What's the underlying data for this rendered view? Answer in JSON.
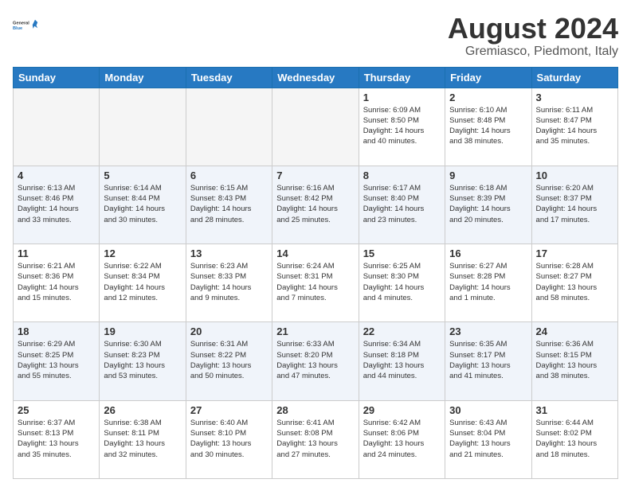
{
  "logo": {
    "line1": "General",
    "line2": "Blue"
  },
  "title": "August 2024",
  "subtitle": "Gremiasco, Piedmont, Italy",
  "days_header": [
    "Sunday",
    "Monday",
    "Tuesday",
    "Wednesday",
    "Thursday",
    "Friday",
    "Saturday"
  ],
  "weeks": [
    [
      {
        "day": "",
        "info": ""
      },
      {
        "day": "",
        "info": ""
      },
      {
        "day": "",
        "info": ""
      },
      {
        "day": "",
        "info": ""
      },
      {
        "day": "1",
        "info": "Sunrise: 6:09 AM\nSunset: 8:50 PM\nDaylight: 14 hours\nand 40 minutes."
      },
      {
        "day": "2",
        "info": "Sunrise: 6:10 AM\nSunset: 8:48 PM\nDaylight: 14 hours\nand 38 minutes."
      },
      {
        "day": "3",
        "info": "Sunrise: 6:11 AM\nSunset: 8:47 PM\nDaylight: 14 hours\nand 35 minutes."
      }
    ],
    [
      {
        "day": "4",
        "info": "Sunrise: 6:13 AM\nSunset: 8:46 PM\nDaylight: 14 hours\nand 33 minutes."
      },
      {
        "day": "5",
        "info": "Sunrise: 6:14 AM\nSunset: 8:44 PM\nDaylight: 14 hours\nand 30 minutes."
      },
      {
        "day": "6",
        "info": "Sunrise: 6:15 AM\nSunset: 8:43 PM\nDaylight: 14 hours\nand 28 minutes."
      },
      {
        "day": "7",
        "info": "Sunrise: 6:16 AM\nSunset: 8:42 PM\nDaylight: 14 hours\nand 25 minutes."
      },
      {
        "day": "8",
        "info": "Sunrise: 6:17 AM\nSunset: 8:40 PM\nDaylight: 14 hours\nand 23 minutes."
      },
      {
        "day": "9",
        "info": "Sunrise: 6:18 AM\nSunset: 8:39 PM\nDaylight: 14 hours\nand 20 minutes."
      },
      {
        "day": "10",
        "info": "Sunrise: 6:20 AM\nSunset: 8:37 PM\nDaylight: 14 hours\nand 17 minutes."
      }
    ],
    [
      {
        "day": "11",
        "info": "Sunrise: 6:21 AM\nSunset: 8:36 PM\nDaylight: 14 hours\nand 15 minutes."
      },
      {
        "day": "12",
        "info": "Sunrise: 6:22 AM\nSunset: 8:34 PM\nDaylight: 14 hours\nand 12 minutes."
      },
      {
        "day": "13",
        "info": "Sunrise: 6:23 AM\nSunset: 8:33 PM\nDaylight: 14 hours\nand 9 minutes."
      },
      {
        "day": "14",
        "info": "Sunrise: 6:24 AM\nSunset: 8:31 PM\nDaylight: 14 hours\nand 7 minutes."
      },
      {
        "day": "15",
        "info": "Sunrise: 6:25 AM\nSunset: 8:30 PM\nDaylight: 14 hours\nand 4 minutes."
      },
      {
        "day": "16",
        "info": "Sunrise: 6:27 AM\nSunset: 8:28 PM\nDaylight: 14 hours\nand 1 minute."
      },
      {
        "day": "17",
        "info": "Sunrise: 6:28 AM\nSunset: 8:27 PM\nDaylight: 13 hours\nand 58 minutes."
      }
    ],
    [
      {
        "day": "18",
        "info": "Sunrise: 6:29 AM\nSunset: 8:25 PM\nDaylight: 13 hours\nand 55 minutes."
      },
      {
        "day": "19",
        "info": "Sunrise: 6:30 AM\nSunset: 8:23 PM\nDaylight: 13 hours\nand 53 minutes."
      },
      {
        "day": "20",
        "info": "Sunrise: 6:31 AM\nSunset: 8:22 PM\nDaylight: 13 hours\nand 50 minutes."
      },
      {
        "day": "21",
        "info": "Sunrise: 6:33 AM\nSunset: 8:20 PM\nDaylight: 13 hours\nand 47 minutes."
      },
      {
        "day": "22",
        "info": "Sunrise: 6:34 AM\nSunset: 8:18 PM\nDaylight: 13 hours\nand 44 minutes."
      },
      {
        "day": "23",
        "info": "Sunrise: 6:35 AM\nSunset: 8:17 PM\nDaylight: 13 hours\nand 41 minutes."
      },
      {
        "day": "24",
        "info": "Sunrise: 6:36 AM\nSunset: 8:15 PM\nDaylight: 13 hours\nand 38 minutes."
      }
    ],
    [
      {
        "day": "25",
        "info": "Sunrise: 6:37 AM\nSunset: 8:13 PM\nDaylight: 13 hours\nand 35 minutes."
      },
      {
        "day": "26",
        "info": "Sunrise: 6:38 AM\nSunset: 8:11 PM\nDaylight: 13 hours\nand 32 minutes."
      },
      {
        "day": "27",
        "info": "Sunrise: 6:40 AM\nSunset: 8:10 PM\nDaylight: 13 hours\nand 30 minutes."
      },
      {
        "day": "28",
        "info": "Sunrise: 6:41 AM\nSunset: 8:08 PM\nDaylight: 13 hours\nand 27 minutes."
      },
      {
        "day": "29",
        "info": "Sunrise: 6:42 AM\nSunset: 8:06 PM\nDaylight: 13 hours\nand 24 minutes."
      },
      {
        "day": "30",
        "info": "Sunrise: 6:43 AM\nSunset: 8:04 PM\nDaylight: 13 hours\nand 21 minutes."
      },
      {
        "day": "31",
        "info": "Sunrise: 6:44 AM\nSunset: 8:02 PM\nDaylight: 13 hours\nand 18 minutes."
      }
    ]
  ]
}
